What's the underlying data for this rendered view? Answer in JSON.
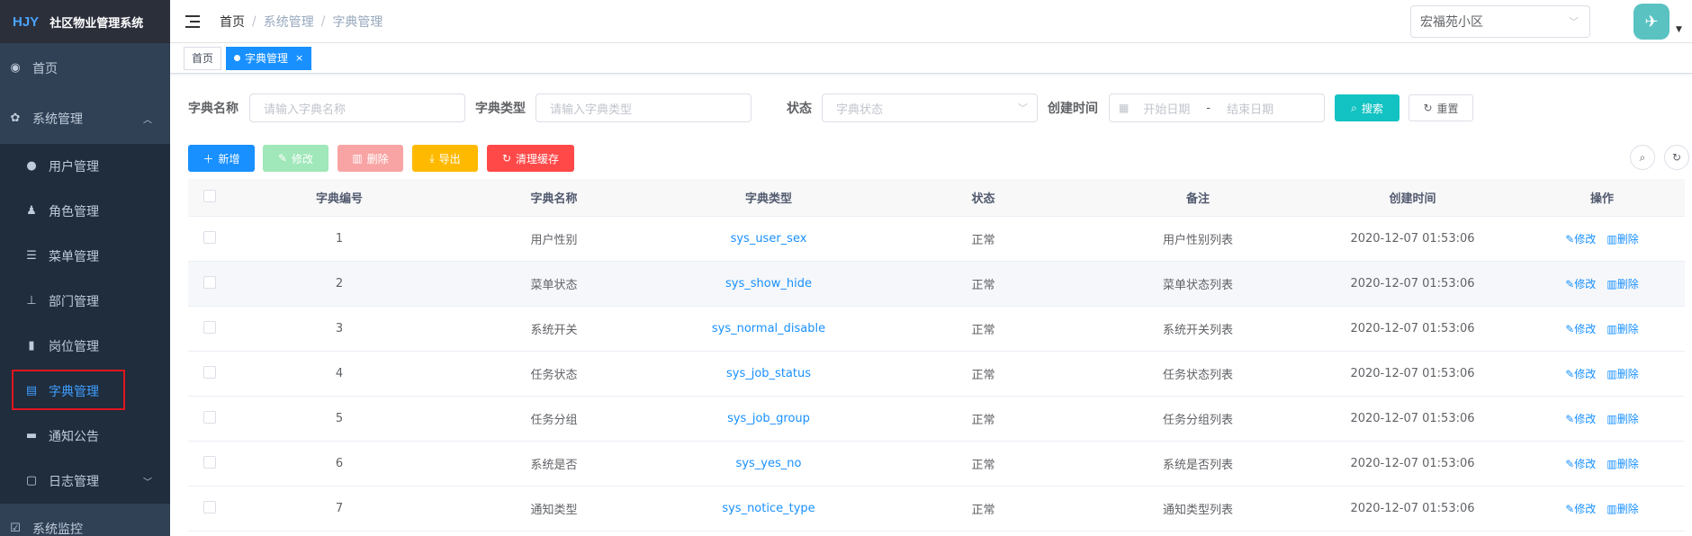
{
  "sidebar": {
    "logo_abbr": "HJY",
    "logo_name": "社区物业管理系统",
    "home": "首页",
    "system": "系统管理",
    "items": [
      {
        "label": "用户管理",
        "icon": "user-icon"
      },
      {
        "label": "角色管理",
        "icon": "peoples-icon"
      },
      {
        "label": "菜单管理",
        "icon": "tree-table-icon"
      },
      {
        "label": "部门管理",
        "icon": "tree-icon"
      },
      {
        "label": "岗位管理",
        "icon": "post-icon"
      },
      {
        "label": "字典管理",
        "icon": "dict-icon"
      },
      {
        "label": "通知公告",
        "icon": "message-icon"
      },
      {
        "label": "日志管理",
        "icon": "log-icon"
      }
    ],
    "monitor": "系统监控"
  },
  "navbar": {
    "breadcrumb": [
      "首页",
      "系统管理",
      "字典管理"
    ],
    "community": "宏福苑小区"
  },
  "tags": {
    "home": "首页",
    "active": "字典管理"
  },
  "search": {
    "name_label": "字典名称",
    "name_placeholder": "请输入字典名称",
    "type_label": "字典类型",
    "type_placeholder": "请输入字典类型",
    "status_label": "状态",
    "status_placeholder": "字典状态",
    "date_label": "创建时间",
    "start_placeholder": "开始日期",
    "date_sep": "-",
    "end_placeholder": "结束日期",
    "search_btn": "搜索",
    "reset_btn": "重置"
  },
  "toolbar": {
    "add": "新增",
    "edit": "修改",
    "delete": "删除",
    "export": "导出",
    "clear_cache": "清理缓存"
  },
  "colors": {
    "primary": "#1890ff",
    "success": "#13ce66",
    "danger": "#ff4949",
    "warning": "#ffba00",
    "teal": "#13c2c2",
    "sidebar_bg": "#304156"
  },
  "table": {
    "headers": [
      "字典编号",
      "字典名称",
      "字典类型",
      "状态",
      "备注",
      "创建时间",
      "操作"
    ],
    "rows": [
      {
        "id": "1",
        "name": "用户性别",
        "type": "sys_user_sex",
        "status": "正常",
        "remark": "用户性别列表",
        "time": "2020-12-07 01:53:06"
      },
      {
        "id": "2",
        "name": "菜单状态",
        "type": "sys_show_hide",
        "status": "正常",
        "remark": "菜单状态列表",
        "time": "2020-12-07 01:53:06"
      },
      {
        "id": "3",
        "name": "系统开关",
        "type": "sys_normal_disable",
        "status": "正常",
        "remark": "系统开关列表",
        "time": "2020-12-07 01:53:06"
      },
      {
        "id": "4",
        "name": "任务状态",
        "type": "sys_job_status",
        "status": "正常",
        "remark": "任务状态列表",
        "time": "2020-12-07 01:53:06"
      },
      {
        "id": "5",
        "name": "任务分组",
        "type": "sys_job_group",
        "status": "正常",
        "remark": "任务分组列表",
        "time": "2020-12-07 01:53:06"
      },
      {
        "id": "6",
        "name": "系统是否",
        "type": "sys_yes_no",
        "status": "正常",
        "remark": "系统是否列表",
        "time": "2020-12-07 01:53:06"
      },
      {
        "id": "7",
        "name": "通知类型",
        "type": "sys_notice_type",
        "status": "正常",
        "remark": "通知类型列表",
        "time": "2020-12-07 01:53:06"
      }
    ],
    "op_edit": "修改",
    "op_delete": "删除"
  }
}
